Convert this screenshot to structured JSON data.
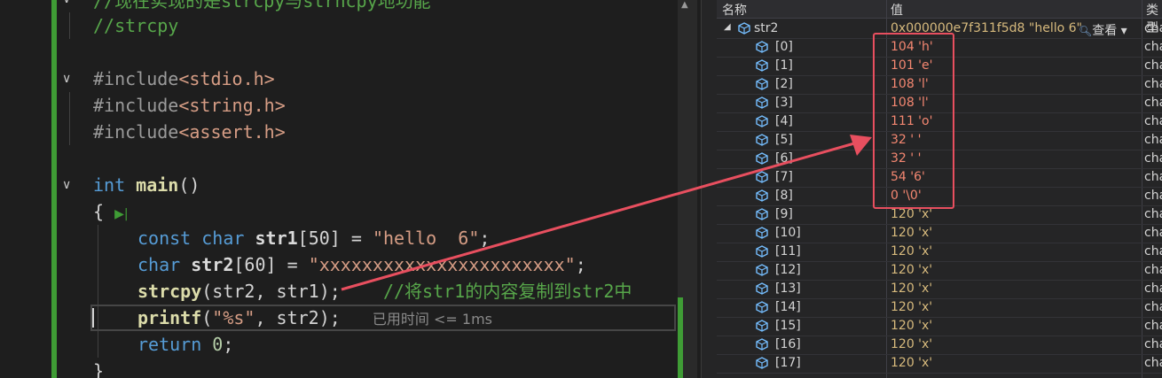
{
  "editor": {
    "lines": {
      "comment1": "//现在实现的是strcpy与strncpy地功能",
      "comment2": "//strcpy",
      "inc1_kw": "#include",
      "inc1_file": "<stdio.h>",
      "inc2_kw": "#include",
      "inc2_file": "<string.h>",
      "inc3_kw": "#include",
      "inc3_file": "<assert.h>",
      "main_type": "int",
      "main_name": "main",
      "main_parens": "()",
      "open_brace": "{",
      "l1_const": "const",
      "l1_char": "char",
      "l1_id": "str1",
      "l1_rest": "[50] = ",
      "l1_str": "\"hello  6\"",
      "l1_end": ";",
      "l2_char": "char",
      "l2_id": "str2",
      "l2_rest": "[60] = ",
      "l2_str": "\"xxxxxxxxxxxxxxxxxxxxxxx\"",
      "l2_end": ";",
      "l3_fn": "strcpy",
      "l3_args": "(str2, str1);",
      "l3_comment": "//将str1的内容复制到str2中",
      "l4_fn": "printf",
      "l4_open": "(",
      "l4_str": "\"%s\"",
      "l4_rest": ", str2);",
      "l4_timing": "已用时间 <= 1ms",
      "l5_kw": "return",
      "l5_num": "0",
      "l5_end": ";",
      "close_brace": "}"
    }
  },
  "watch": {
    "header": {
      "name": "名称",
      "value": "值",
      "type": "类型"
    },
    "root": {
      "name": "str2",
      "value": "0x000000e7f311f5d8 \"hello  6\"",
      "view": "查看",
      "type": "cha"
    },
    "rows": [
      {
        "name": "[0]",
        "value": "104 'h'",
        "type": "cha",
        "changed": true
      },
      {
        "name": "[1]",
        "value": "101 'e'",
        "type": "cha",
        "changed": true
      },
      {
        "name": "[2]",
        "value": "108 'l'",
        "type": "cha",
        "changed": true
      },
      {
        "name": "[3]",
        "value": "108 'l'",
        "type": "cha",
        "changed": true
      },
      {
        "name": "[4]",
        "value": "111 'o'",
        "type": "cha",
        "changed": true
      },
      {
        "name": "[5]",
        "value": "32 ' '",
        "type": "cha",
        "changed": true
      },
      {
        "name": "[6]",
        "value": "32 ' '",
        "type": "cha",
        "changed": true
      },
      {
        "name": "[7]",
        "value": "54 '6'",
        "type": "cha",
        "changed": true
      },
      {
        "name": "[8]",
        "value": "0 '\\0'",
        "type": "cha",
        "changed": true
      },
      {
        "name": "[9]",
        "value": "120 'x'",
        "type": "cha",
        "changed": false
      },
      {
        "name": "[10]",
        "value": "120 'x'",
        "type": "cha",
        "changed": false
      },
      {
        "name": "[11]",
        "value": "120 'x'",
        "type": "cha",
        "changed": false
      },
      {
        "name": "[12]",
        "value": "120 'x'",
        "type": "cha",
        "changed": false
      },
      {
        "name": "[13]",
        "value": "120 'x'",
        "type": "cha",
        "changed": false
      },
      {
        "name": "[14]",
        "value": "120 'x'",
        "type": "cha",
        "changed": false
      },
      {
        "name": "[15]",
        "value": "120 'x'",
        "type": "cha",
        "changed": false
      },
      {
        "name": "[16]",
        "value": "120 'x'",
        "type": "cha",
        "changed": false
      },
      {
        "name": "[17]",
        "value": "120 'x'",
        "type": "cha",
        "changed": false
      }
    ]
  },
  "colors": {
    "annotation": "#e84f5f",
    "changed_value": "#f48771",
    "value": "#d7ba7d",
    "gutter_green": "#3f9c35"
  },
  "icons": {
    "fold": "chevron-down-icon",
    "variable": "cube-icon",
    "expand": "triangle-down-icon",
    "view": "magnifier-icon",
    "continue": "play-icon"
  }
}
